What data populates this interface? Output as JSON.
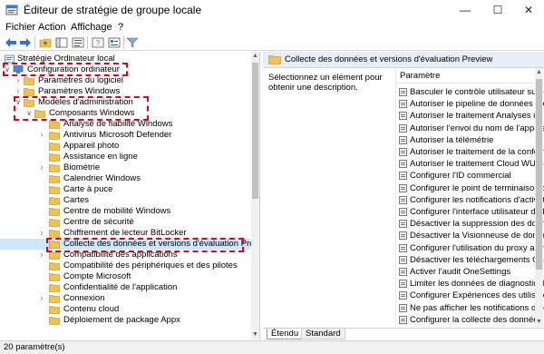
{
  "window": {
    "title": "Éditeur de stratégie de groupe locale",
    "minimize": "—",
    "maximize": "☐",
    "close": "✕"
  },
  "menu": [
    "Fichier",
    "Action",
    "Affichage",
    "?"
  ],
  "toolbar": {
    "icons": [
      "back-icon",
      "forward-icon",
      "folder-up-icon",
      "show-hide-tree-icon",
      "export-list-icon",
      "help-icon",
      "properties-icon",
      "filter-icon"
    ]
  },
  "tree": {
    "root": "Stratégie Ordinateur local",
    "computer_config": "Configuration ordinateur",
    "software_settings": "Paramètres du logiciel",
    "windows_settings": "Paramètres Windows",
    "admin_templates": "Modèles d'administration",
    "windows_components": "Composants Windows",
    "components": [
      "Analyse de fiabilité Windows",
      "Antivirus Microsoft Defender",
      "Appareil photo",
      "Assistance en ligne",
      "Biométrie",
      "Calendrier Windows",
      "Carte à puce",
      "Cartes",
      "Centre de mobilité Windows",
      "Centre de sécurité",
      "Chiffrement de lecteur BitLocker",
      "Collecte des données et versions d'évaluation Preview",
      "Compatibilité des applications",
      "Compatibilité des périphériques et des pilotes",
      "Compte Microsoft",
      "Confidentialité de l'application",
      "Connexion",
      "Contenu cloud",
      "Déploiement de package Appx"
    ],
    "selected_index": 11
  },
  "details": {
    "header_title": "Collecte des données et versions d'évaluation Preview",
    "description": "Sélectionnez un élément pour obtenir une description.",
    "column_header": "Paramètre",
    "settings": [
      "Basculer le contrôle utilisateur sur les l",
      "Autoriser le pipeline de données comm",
      "Autoriser le traitement Analyses du bu",
      "Autoriser l'envoi du nom de l'appareil",
      "Autoriser la télémétrie",
      "Autoriser le traitement de la conformit",
      "Autoriser le traitement Cloud WUfB",
      "Configurer l'ID commercial",
      "Configurer le point de terminaison de",
      "Configurer les notifications d'activati",
      "Configurer l'interface utilisateur de l'a",
      "Désactiver la suppression des données",
      "Désactiver la Visionneuse de données d",
      "Configurer l'utilisation du proxy authe",
      "Désactiver les téléchargements OneSe",
      "Activer l'audit OneSettings",
      "Limiter les données de diagnostic de r",
      "Configurer Expériences des utilisateurs",
      "Ne pas afficher les notifications de con",
      "Configurer la collecte des données de"
    ]
  },
  "tabs": [
    "Étendu",
    "Standard"
  ],
  "status": "20 paramètre(s)",
  "colors": {
    "highlight": "#e3001b",
    "folder": "#f2c14e",
    "selection": "#cce8ff"
  }
}
